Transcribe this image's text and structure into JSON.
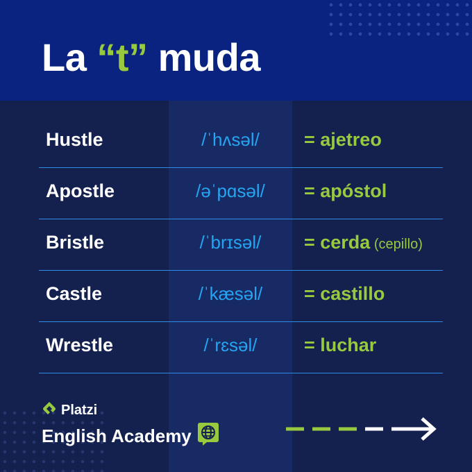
{
  "title": {
    "prefix": "La ",
    "accent": "“t”",
    "suffix": " muda"
  },
  "rows": [
    {
      "word": "Hustle",
      "ipa": "/ˈhʌsəl/",
      "translation": "= ajetreo",
      "extra": ""
    },
    {
      "word": "Apostle",
      "ipa": "/əˈpɑsəl/",
      "translation": "= apóstol",
      "extra": ""
    },
    {
      "word": "Bristle",
      "ipa": "/ˈbrɪsəl/",
      "translation": "= cerda",
      "extra": " (cepillo)"
    },
    {
      "word": "Castle",
      "ipa": "/ˈkæsəl/",
      "translation": "= castillo",
      "extra": ""
    },
    {
      "word": "Wrestle",
      "ipa": "/ˈrɛsəl/",
      "translation": "= luchar",
      "extra": ""
    }
  ],
  "brand": {
    "name": "Platzi",
    "tagline": "English Academy"
  },
  "colors": {
    "header_bg": "#0a2380",
    "body_bg": "#14214f",
    "accent_green": "#98ca3f",
    "ipa_blue": "#27a4f1",
    "divider_blue": "#2e8ee6"
  },
  "icons": {
    "logo": "platzi-logo-icon",
    "globe": "globe-chat-icon",
    "arrow": "dashed-arrow-right-icon"
  }
}
